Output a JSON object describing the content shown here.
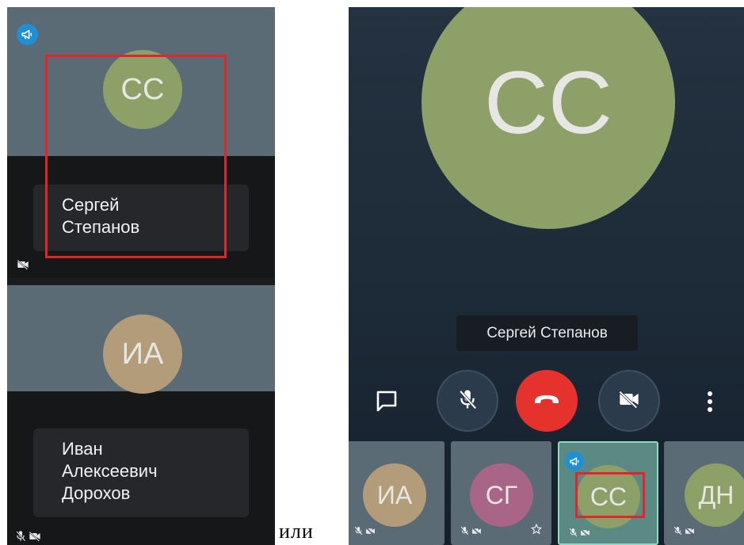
{
  "left_panel": {
    "tiles": [
      {
        "initials": "СС",
        "name_lines": [
          "Сергей",
          "Степанов"
        ],
        "avatar_color": "#8ca068",
        "status_icons": [
          "camera-off-icon"
        ],
        "has_megaphone_badge": true,
        "highlighted": true
      },
      {
        "initials": "ИА",
        "name_lines": [
          "Иван",
          "Алексеевич",
          "Дорохов"
        ],
        "avatar_color": "#b39c7a",
        "status_icons": [
          "mic-off-icon",
          "camera-off-icon"
        ],
        "has_megaphone_badge": false,
        "highlighted": false
      }
    ]
  },
  "separator_text": "или",
  "right_panel": {
    "active_speaker": {
      "initials": "СС",
      "name": "Сергей Степанов",
      "avatar_color": "#8ca068"
    },
    "controls": [
      {
        "name": "chat-button",
        "icon": "chat-icon"
      },
      {
        "name": "mute-button",
        "icon": "mic-off-icon"
      },
      {
        "name": "hang-up-button",
        "icon": "phone-hangup-icon",
        "color": "#e5322d"
      },
      {
        "name": "camera-button",
        "icon": "camera-off-icon"
      },
      {
        "name": "more-button",
        "icon": "more-vertical-icon"
      }
    ],
    "participants": [
      {
        "initials": "ИА",
        "avatar_color": "#b39c7a",
        "status_icons": [
          "mic-off-icon",
          "camera-off-icon"
        ]
      },
      {
        "initials": "СГ",
        "avatar_color": "#a86586",
        "status_icons": [
          "mic-off-icon",
          "camera-off-icon"
        ],
        "starred": true
      },
      {
        "initials": "СС",
        "avatar_color": "#8ca068",
        "status_icons": [
          "mic-off-icon",
          "camera-off-icon"
        ],
        "active": true,
        "has_megaphone_badge": true,
        "highlighted": true
      },
      {
        "initials": "ДН",
        "avatar_color": "#8ca068",
        "status_icons": [
          "mic-off-icon",
          "camera-off-icon"
        ]
      }
    ]
  },
  "colors": {
    "tile_background": "#5b6b76",
    "highlight_frame": "#e1252b",
    "megaphone_badge": "#1f8fd6",
    "active_tile_border": "#8fd6c5"
  }
}
